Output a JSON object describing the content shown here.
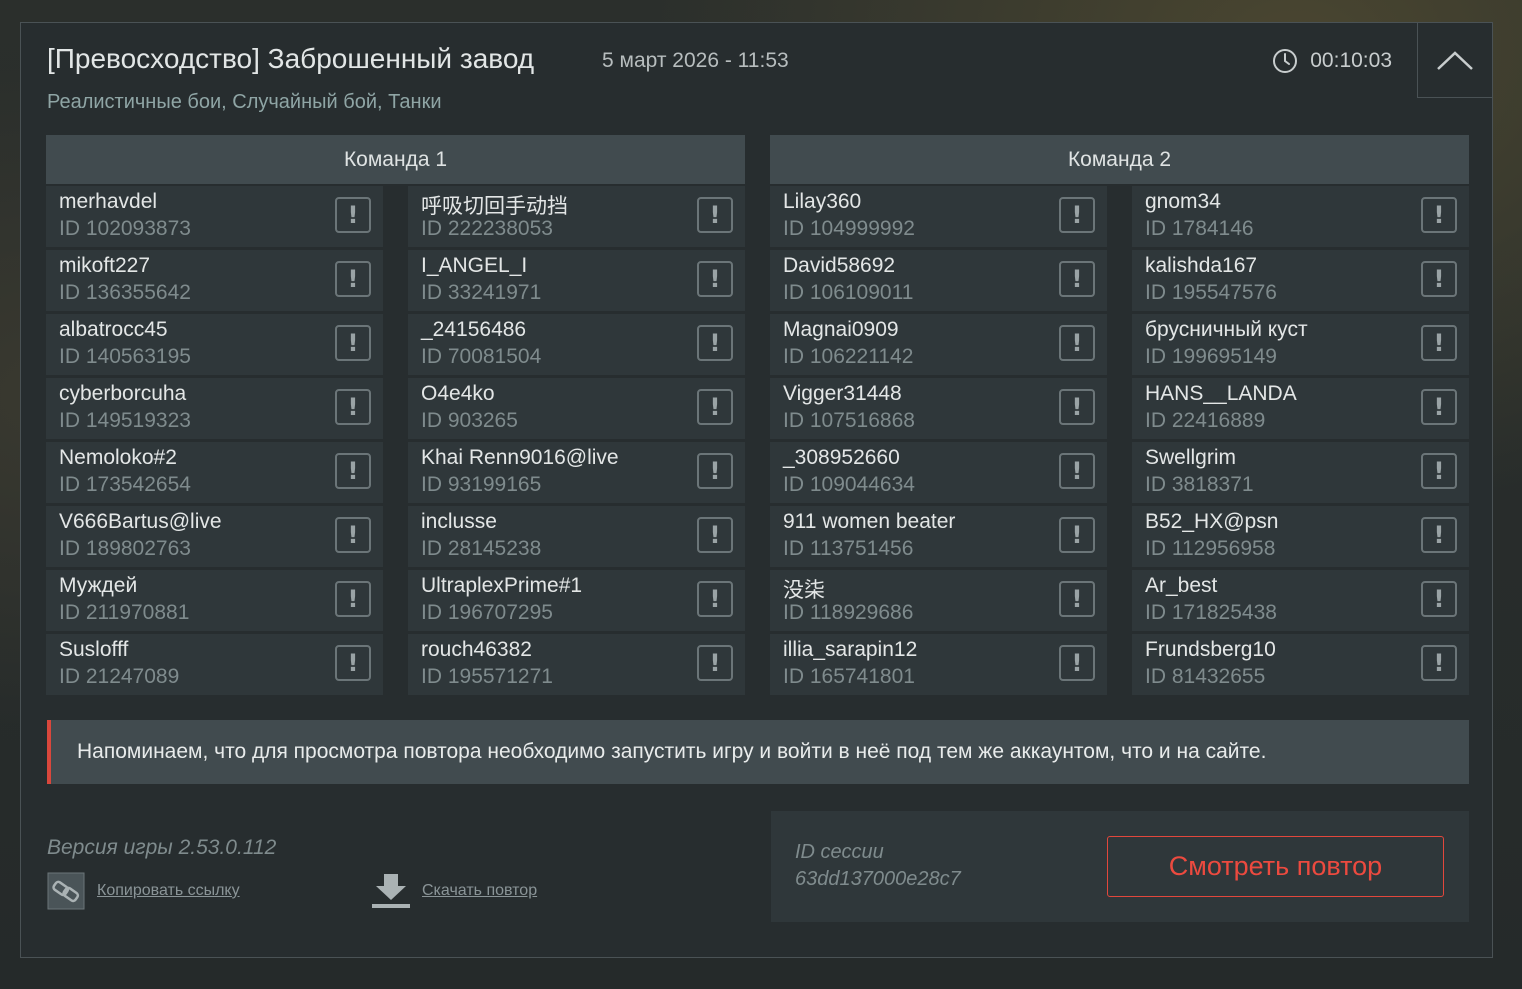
{
  "header": {
    "title": "[Превосходство] Заброшенный завод",
    "date": "5 март 2026 - 11:53",
    "subtitle": "Реалистичные бои, Случайный бой, Танки",
    "duration": "00:10:03",
    "clock_icon": "clock-icon",
    "collapse_icon": "chevron-up-icon"
  },
  "teams": [
    {
      "name": "Команда 1",
      "players": [
        {
          "name": "merhavdel",
          "id": "ID 102093873"
        },
        {
          "name": "呼吸切回手动挡",
          "id": "ID 222238053"
        },
        {
          "name": "mikoft227",
          "id": "ID 136355642"
        },
        {
          "name": "I_ANGEL_I",
          "id": "ID 33241971"
        },
        {
          "name": "albatrocc45",
          "id": "ID 140563195"
        },
        {
          "name": "_24156486",
          "id": "ID 70081504"
        },
        {
          "name": "cyberborcuha",
          "id": "ID 149519323"
        },
        {
          "name": "O4e4ko",
          "id": "ID 903265"
        },
        {
          "name": "Nemoloko#2",
          "id": "ID 173542654"
        },
        {
          "name": "Khai Renn9016@live",
          "id": "ID 93199165"
        },
        {
          "name": "V666Bartus@live",
          "id": "ID 189802763"
        },
        {
          "name": "inclusse",
          "id": "ID 28145238"
        },
        {
          "name": "Муждей",
          "id": "ID 211970881"
        },
        {
          "name": "UltraplexPrime#1",
          "id": "ID 196707295"
        },
        {
          "name": "Suslofff",
          "id": "ID 21247089"
        },
        {
          "name": "rouch46382",
          "id": "ID 195571271"
        }
      ]
    },
    {
      "name": "Команда 2",
      "players": [
        {
          "name": "Lilay360",
          "id": "ID 104999992"
        },
        {
          "name": "gnom34",
          "id": "ID 1784146"
        },
        {
          "name": "David58692",
          "id": "ID 106109011"
        },
        {
          "name": "kalishda167",
          "id": "ID 195547576"
        },
        {
          "name": "Magnai0909",
          "id": "ID 106221142"
        },
        {
          "name": "брусничный куст",
          "id": "ID 199695149"
        },
        {
          "name": "Vigger31448",
          "id": "ID 107516868"
        },
        {
          "name": "HANS__LANDA",
          "id": "ID 22416889"
        },
        {
          "name": "_308952660",
          "id": "ID 109044634"
        },
        {
          "name": "Swellgrim",
          "id": "ID 3818371"
        },
        {
          "name": "911 women beater",
          "id": "ID 113751456"
        },
        {
          "name": "B52_HX@psn",
          "id": "ID 112956958"
        },
        {
          "name": "没柒",
          "id": "ID 118929686"
        },
        {
          "name": "Ar_best",
          "id": "ID 171825438"
        },
        {
          "name": "illia_sarapin12",
          "id": "ID 165741801"
        },
        {
          "name": "Frundsberg10",
          "id": "ID 81432655"
        }
      ]
    }
  ],
  "report_symbol": "!",
  "notice": "Напоминаем, что для просмотра повтора необходимо запустить игру и войти в неё под тем же аккаунтом, что и на сайте.",
  "footer": {
    "version": "Версия игры 2.53.0.112",
    "copy_link": "Копировать ссылку",
    "download": "Скачать повтор",
    "session_label": "ID сессии",
    "session_id": "63dd137000e28c7",
    "watch_button": "Смотреть повтор"
  },
  "colors": {
    "accent_red": "#ec4a3f",
    "panel_bg": "#272d2f",
    "header_bg": "#414b4f"
  }
}
